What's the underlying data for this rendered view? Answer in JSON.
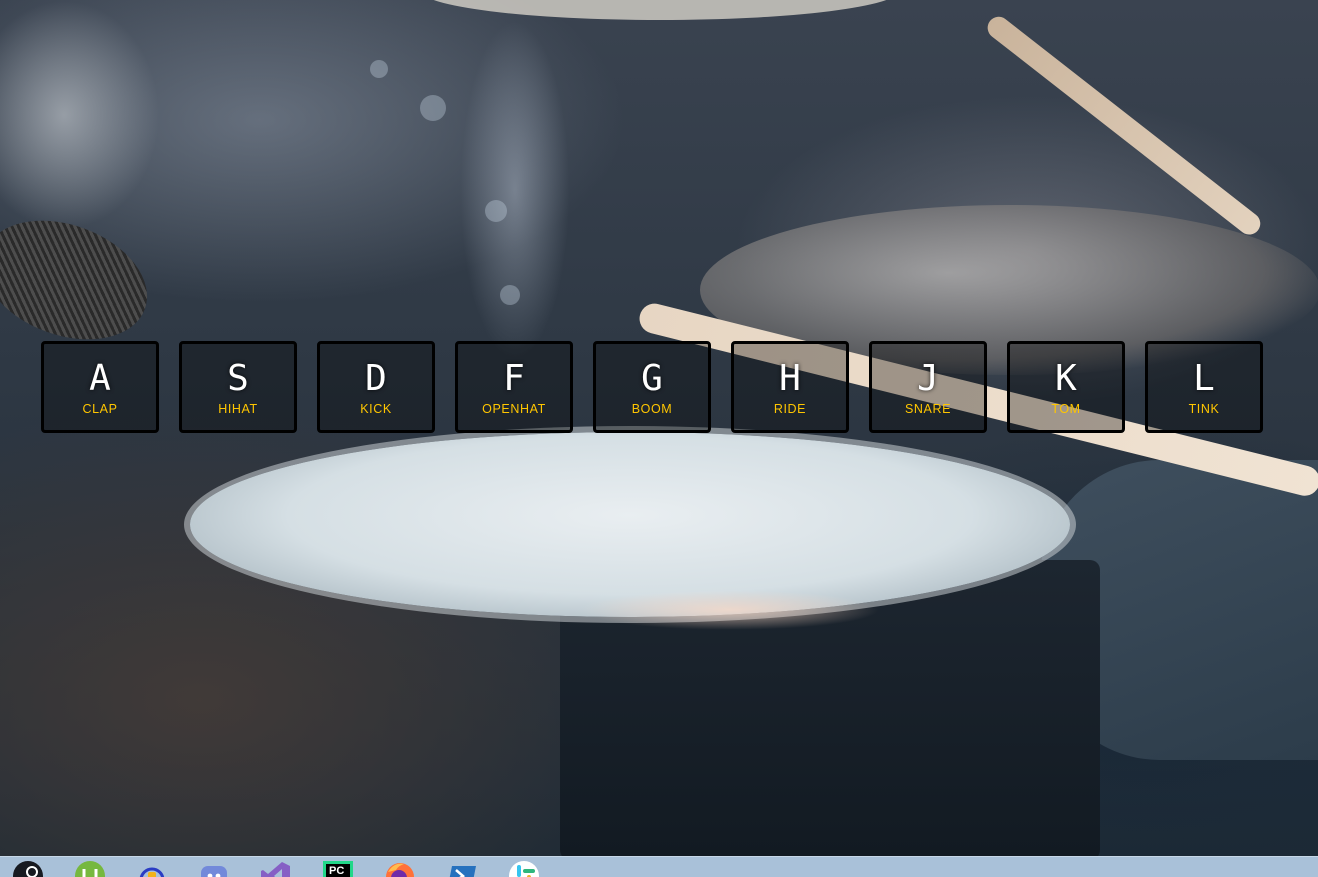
{
  "keys": [
    {
      "letter": "A",
      "sound": "CLAP"
    },
    {
      "letter": "S",
      "sound": "HIHAT"
    },
    {
      "letter": "D",
      "sound": "KICK"
    },
    {
      "letter": "F",
      "sound": "OPENHAT"
    },
    {
      "letter": "G",
      "sound": "BOOM"
    },
    {
      "letter": "H",
      "sound": "RIDE"
    },
    {
      "letter": "J",
      "sound": "SNARE"
    },
    {
      "letter": "K",
      "sound": "TOM"
    },
    {
      "letter": "L",
      "sound": "TINK"
    }
  ],
  "taskbar": {
    "icons": [
      "steam-icon",
      "utorrent-icon",
      "headset-app-icon",
      "discord-icon",
      "visual-studio-icon",
      "pycharm-icon",
      "firefox-icon",
      "powershell-icon",
      "slack-icon"
    ],
    "pycharm_label": "PC"
  },
  "colors": {
    "key_sound_text": "#ffc600",
    "key_letter_text": "#ffffff",
    "key_border": "#000000",
    "taskbar_bg": "#a9c1d9"
  }
}
